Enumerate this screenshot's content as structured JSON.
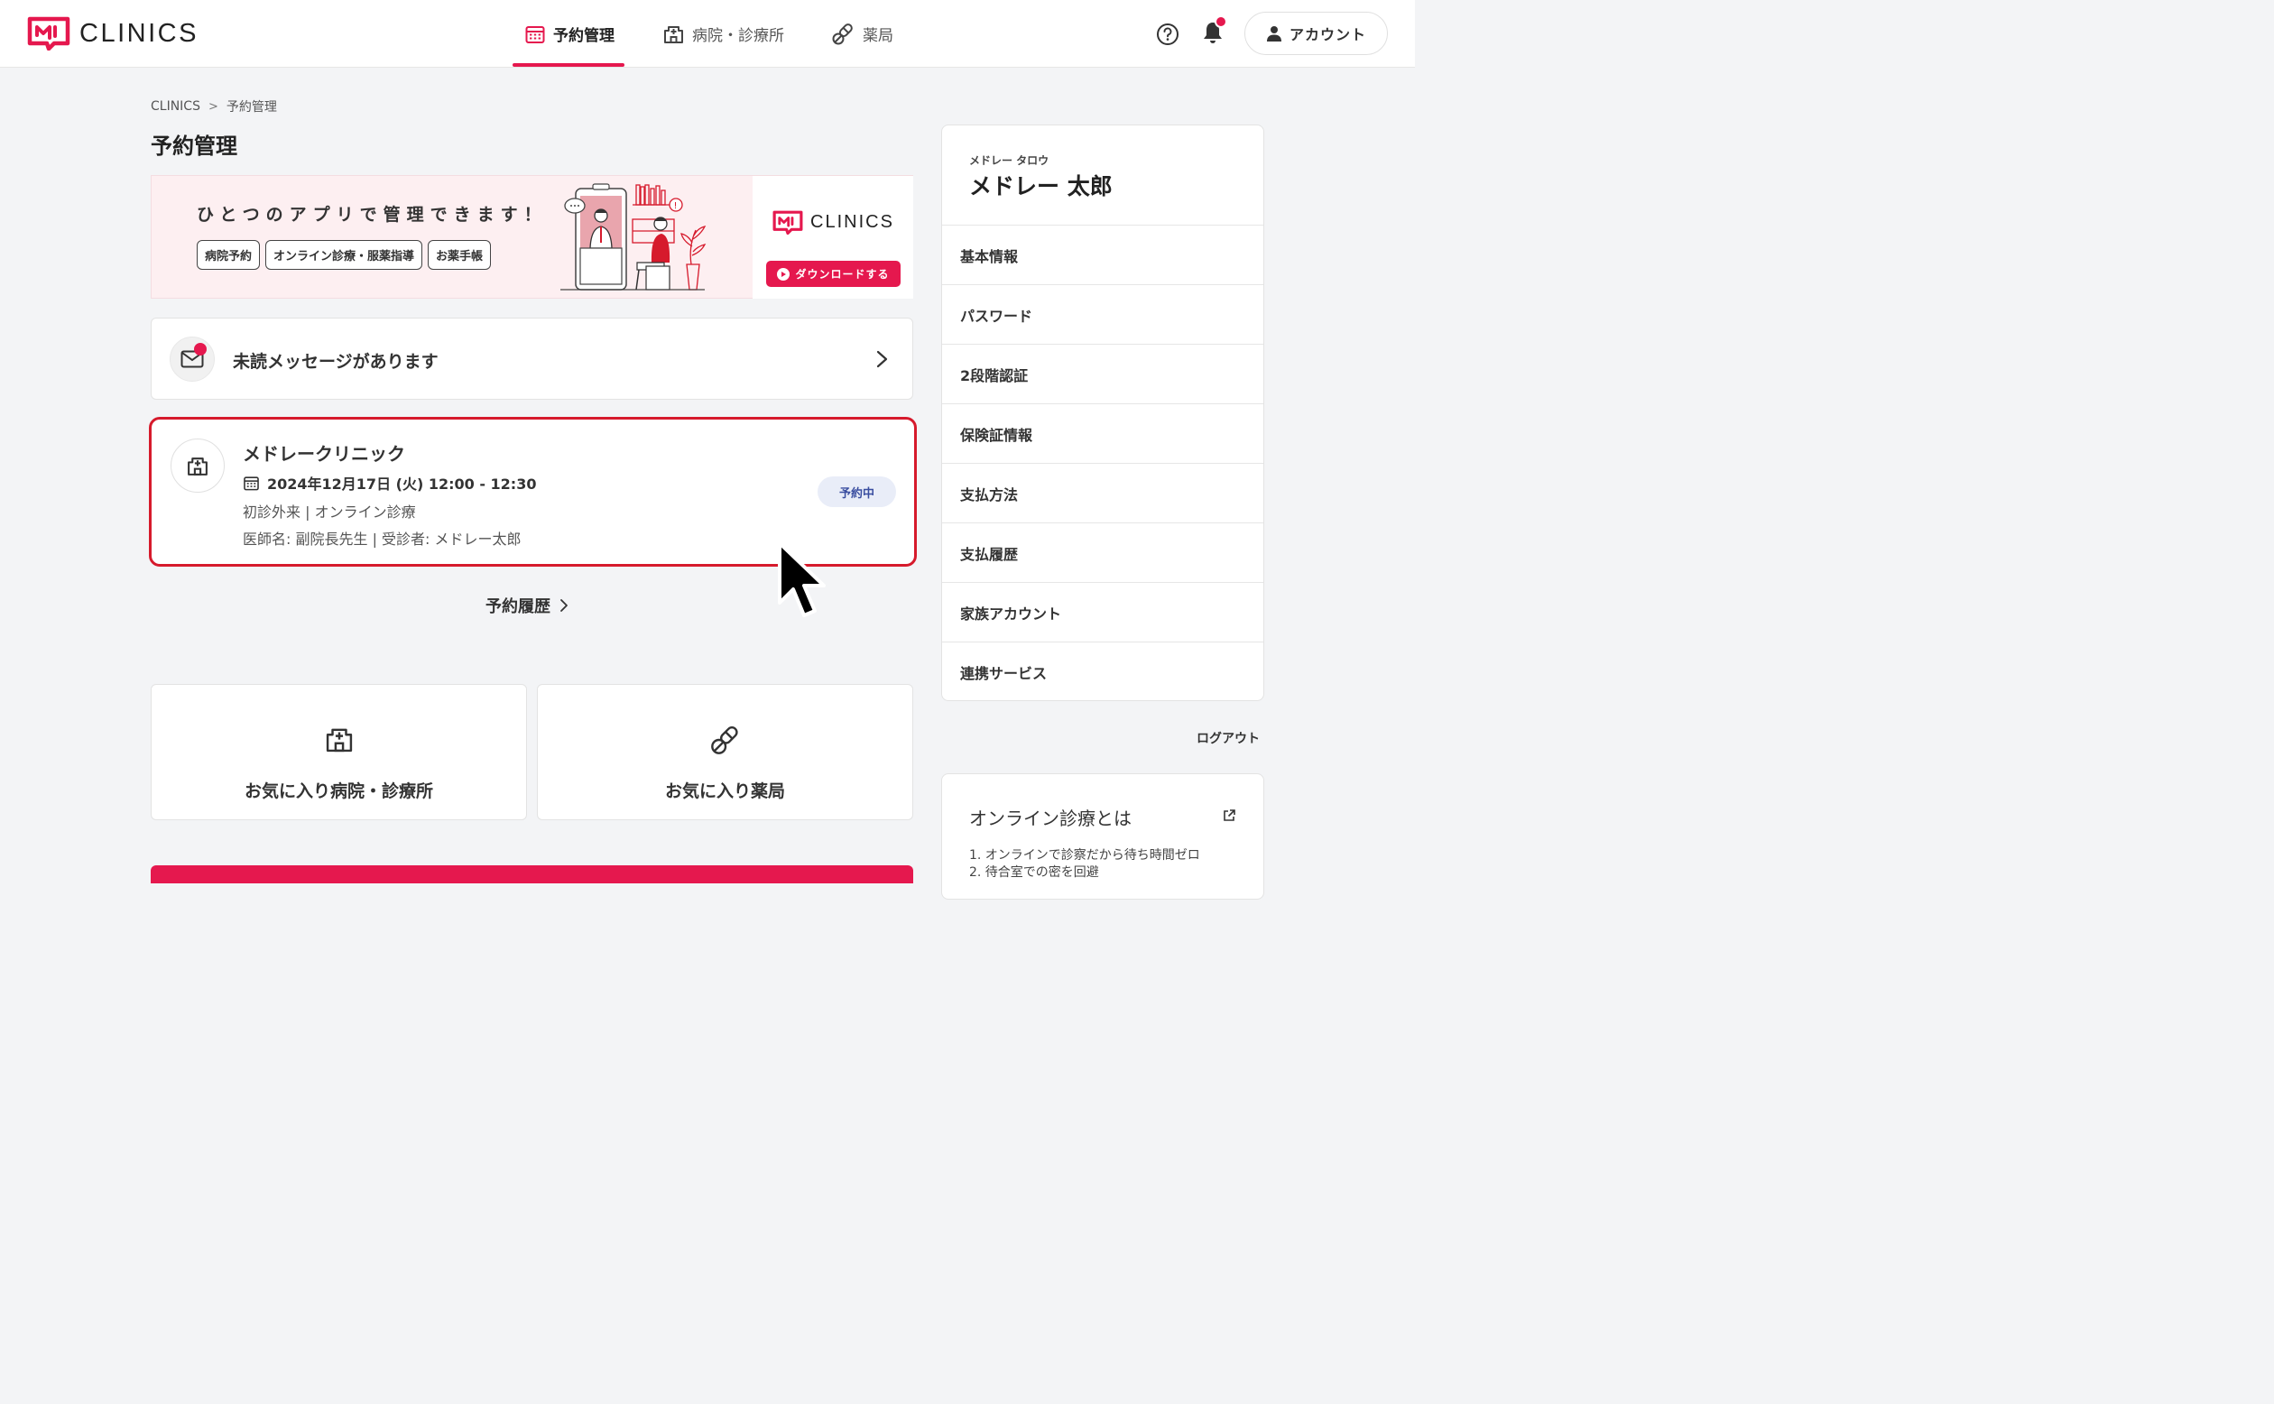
{
  "header": {
    "logo_text": "CLINICS",
    "nav": [
      {
        "label": "予約管理",
        "active": true
      },
      {
        "label": "病院・診療所",
        "active": false
      },
      {
        "label": "薬局",
        "active": false
      }
    ],
    "account_label": "アカウント"
  },
  "breadcrumb": {
    "root": "CLINICS",
    "current": "予約管理"
  },
  "page_title": "予約管理",
  "banner": {
    "headline": "ひとつのアプリで管理できます！",
    "tags": [
      "病院予約",
      "オンライン診療・服薬指導",
      "お薬手帳"
    ],
    "logo_text": "CLINICS",
    "download_label": "ダウンロードする"
  },
  "messages": {
    "unread_text": "未読メッセージがあります"
  },
  "appointment": {
    "clinic_name": "メドレークリニック",
    "datetime": "2024年12月17日 (火) 12:00 - 12:30",
    "type": "初診外来 | オンライン診療",
    "doctor": "医師名: 副院長先生 | 受診者: メドレー太郎",
    "status": "予約中"
  },
  "history_link": "予約履歴",
  "favorites": {
    "hospitals": "お気に入り病院・診療所",
    "pharmacies": "お気に入り薬局"
  },
  "profile": {
    "kana": "メドレー タロウ",
    "name": "メドレー 太郎",
    "menu": [
      "基本情報",
      "パスワード",
      "2段階認証",
      "保険証情報",
      "支払方法",
      "支払履歴",
      "家族アカウント",
      "連携サービス"
    ]
  },
  "logout_label": "ログアウト",
  "online_info": {
    "title": "オンライン診療とは",
    "items": [
      "1. オンラインで診察だから待ち時間ゼロ",
      "2. 待合室での密を回避"
    ]
  },
  "colors": {
    "brand": "#e5184e",
    "highlight_border": "#d61a2c",
    "status_badge_bg": "#e9edf8",
    "status_badge_text": "#3a4ea0"
  }
}
